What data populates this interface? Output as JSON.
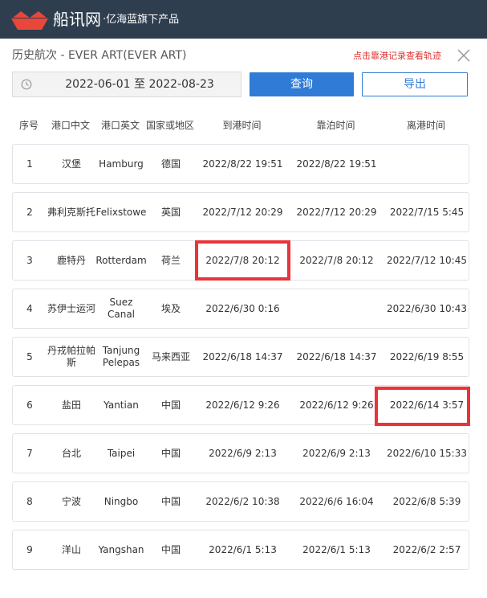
{
  "header": {
    "brand": "船讯网",
    "tagline": "·亿海蓝旗下产品"
  },
  "toolbar": {
    "title": "历史航次 - EVER ART(EVER ART)",
    "track_link": "点击靠港记录查看轨迹",
    "date_range": "2022-06-01 至 2022-08-23",
    "query_label": "查询",
    "export_label": "导出"
  },
  "table": {
    "columns": [
      "序号",
      "港口中文",
      "港口英文",
      "国家或地区",
      "到港时间",
      "靠泊时间",
      "离港时间"
    ],
    "rows": [
      {
        "no": "1",
        "port_cn": "汉堡",
        "port_en": "Hamburg",
        "country": "德国",
        "arrival": "2022/8/22 19:51",
        "berth": "2022/8/22 19:51",
        "departure": ""
      },
      {
        "no": "2",
        "port_cn": "弗利克斯托",
        "port_en": "Felixstowe",
        "country": "英国",
        "arrival": "2022/7/12 20:29",
        "berth": "2022/7/12 20:29",
        "departure": "2022/7/15 5:45"
      },
      {
        "no": "3",
        "port_cn": "鹿特丹",
        "port_en": "Rotterdam",
        "country": "荷兰",
        "arrival": "2022/7/8 20:12",
        "berth": "2022/7/8 20:12",
        "departure": "2022/7/12 10:45"
      },
      {
        "no": "4",
        "port_cn": "苏伊士运河",
        "port_en": "Suez Canal",
        "country": "埃及",
        "arrival": "2022/6/30 0:16",
        "berth": "",
        "departure": "2022/6/30 10:43"
      },
      {
        "no": "5",
        "port_cn": "丹戎帕拉帕斯",
        "port_en": "Tanjung Pelepas",
        "country": "马来西亚",
        "arrival": "2022/6/18 14:37",
        "berth": "2022/6/18 14:37",
        "departure": "2022/6/19 8:55"
      },
      {
        "no": "6",
        "port_cn": "盐田",
        "port_en": "Yantian",
        "country": "中国",
        "arrival": "2022/6/12 9:26",
        "berth": "2022/6/12 9:26",
        "departure": "2022/6/14 3:57"
      },
      {
        "no": "7",
        "port_cn": "台北",
        "port_en": "Taipei",
        "country": "中国",
        "arrival": "2022/6/9 2:13",
        "berth": "2022/6/9 2:13",
        "departure": "2022/6/10 15:33"
      },
      {
        "no": "8",
        "port_cn": "宁波",
        "port_en": "Ningbo",
        "country": "中国",
        "arrival": "2022/6/2 10:38",
        "berth": "2022/6/6 16:04",
        "departure": "2022/6/8 5:39"
      },
      {
        "no": "9",
        "port_cn": "洋山",
        "port_en": "Yangshan",
        "country": "中国",
        "arrival": "2022/6/1 5:13",
        "berth": "2022/6/1 5:13",
        "departure": "2022/6/2 2:57"
      }
    ]
  },
  "colors": {
    "header_bg": "#2f3e4f",
    "logo": "#e8473a",
    "primary": "#2f7bd6",
    "link": "#e03030",
    "highlight": "#e8343a"
  }
}
